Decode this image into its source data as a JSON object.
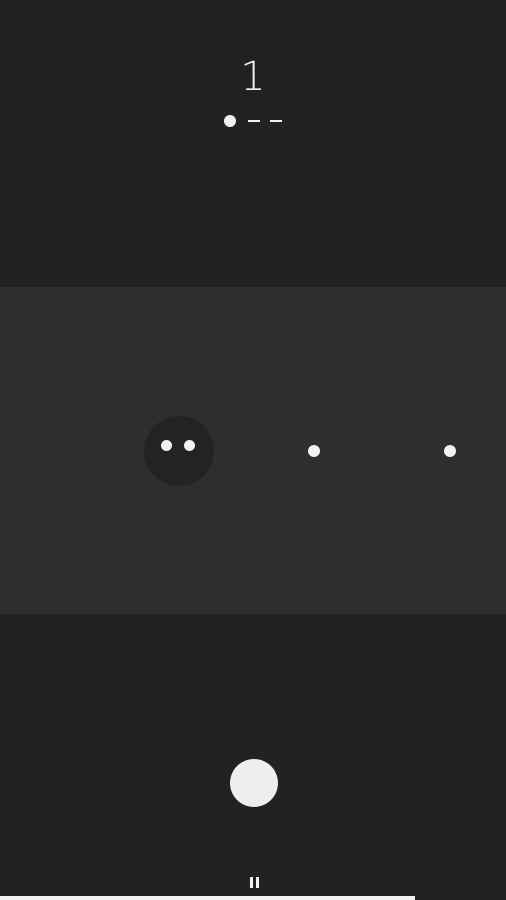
{
  "header": {
    "level_number": "1"
  },
  "stage_progress": {
    "current_stage": 1,
    "total_stages": 3
  },
  "targets": {
    "remaining": 2
  },
  "bottom_progress": {
    "fraction": 0.82
  },
  "icons": {
    "pause": "pause-icon",
    "action": "circle-button-icon"
  },
  "colors": {
    "background": "#222222",
    "band": "#2e2e2e",
    "player": "#232323",
    "foreground": "#f2f2f2"
  }
}
